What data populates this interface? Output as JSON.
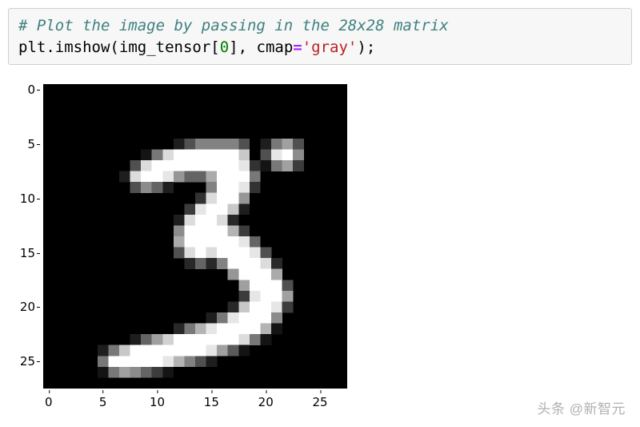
{
  "code": {
    "comment": "# Plot the image by passing in the 28x28 matrix",
    "line2": {
      "obj": "plt",
      "dot": ".",
      "fn": "imshow",
      "open": "(",
      "var": "img_tensor",
      "lb": "[",
      "idx": "0",
      "rb": "]",
      "comma": ", ",
      "kw": "cmap",
      "eq": "=",
      "str": "'gray'",
      "close": ");"
    }
  },
  "chart_data": {
    "type": "heatmap",
    "title": "",
    "xlabel": "",
    "ylabel": "",
    "xlim": [
      -0.5,
      27.5
    ],
    "ylim": [
      27.5,
      -0.5
    ],
    "xticks": [
      0,
      5,
      10,
      15,
      20,
      25
    ],
    "yticks": [
      0,
      5,
      10,
      15,
      20,
      25
    ],
    "cmap": "gray",
    "shape": [
      28,
      28
    ],
    "values": [
      [
        0,
        0,
        0,
        0,
        0,
        0,
        0,
        0,
        0,
        0,
        0,
        0,
        0,
        0,
        0,
        0,
        0,
        0,
        0,
        0,
        0,
        0,
        0,
        0,
        0,
        0,
        0,
        0
      ],
      [
        0,
        0,
        0,
        0,
        0,
        0,
        0,
        0,
        0,
        0,
        0,
        0,
        0,
        0,
        0,
        0,
        0,
        0,
        0,
        0,
        0,
        0,
        0,
        0,
        0,
        0,
        0,
        0
      ],
      [
        0,
        0,
        0,
        0,
        0,
        0,
        0,
        0,
        0,
        0,
        0,
        0,
        0,
        0,
        0,
        0,
        0,
        0,
        0,
        0,
        0,
        0,
        0,
        0,
        0,
        0,
        0,
        0
      ],
      [
        0,
        0,
        0,
        0,
        0,
        0,
        0,
        0,
        0,
        0,
        0,
        0,
        0,
        0,
        0,
        0,
        0,
        0,
        0,
        0,
        0,
        0,
        0,
        0,
        0,
        0,
        0,
        0
      ],
      [
        0,
        0,
        0,
        0,
        0,
        0,
        0,
        0,
        0,
        0,
        0,
        0,
        0,
        0,
        0,
        0,
        0,
        0,
        0,
        0,
        0,
        0,
        0,
        0,
        0,
        0,
        0,
        0
      ],
      [
        0,
        0,
        0,
        0,
        0,
        0,
        0,
        0,
        0,
        0,
        0,
        0,
        30,
        80,
        130,
        130,
        130,
        130,
        80,
        0,
        30,
        120,
        160,
        80,
        0,
        0,
        0,
        0
      ],
      [
        0,
        0,
        0,
        0,
        0,
        0,
        0,
        0,
        0,
        20,
        120,
        220,
        255,
        255,
        255,
        255,
        255,
        255,
        200,
        0,
        80,
        230,
        255,
        140,
        0,
        0,
        0,
        0
      ],
      [
        0,
        0,
        0,
        0,
        0,
        0,
        0,
        0,
        80,
        220,
        255,
        255,
        255,
        255,
        255,
        255,
        255,
        255,
        230,
        50,
        20,
        120,
        160,
        60,
        0,
        0,
        0,
        0
      ],
      [
        0,
        0,
        0,
        0,
        0,
        0,
        0,
        30,
        220,
        255,
        255,
        230,
        150,
        100,
        100,
        170,
        255,
        255,
        255,
        120,
        0,
        0,
        0,
        0,
        0,
        0,
        0,
        0
      ],
      [
        0,
        0,
        0,
        0,
        0,
        0,
        0,
        0,
        80,
        140,
        100,
        30,
        0,
        0,
        0,
        130,
        255,
        255,
        230,
        50,
        0,
        0,
        0,
        0,
        0,
        0,
        0,
        0
      ],
      [
        0,
        0,
        0,
        0,
        0,
        0,
        0,
        0,
        0,
        0,
        0,
        0,
        0,
        0,
        50,
        220,
        255,
        255,
        150,
        0,
        0,
        0,
        0,
        0,
        0,
        0,
        0,
        0
      ],
      [
        0,
        0,
        0,
        0,
        0,
        0,
        0,
        0,
        0,
        0,
        0,
        0,
        0,
        60,
        230,
        255,
        255,
        200,
        30,
        0,
        0,
        0,
        0,
        0,
        0,
        0,
        0,
        0
      ],
      [
        0,
        0,
        0,
        0,
        0,
        0,
        0,
        0,
        0,
        0,
        0,
        0,
        30,
        220,
        255,
        255,
        220,
        40,
        0,
        0,
        0,
        0,
        0,
        0,
        0,
        0,
        0,
        0
      ],
      [
        0,
        0,
        0,
        0,
        0,
        0,
        0,
        0,
        0,
        0,
        0,
        0,
        140,
        255,
        255,
        255,
        255,
        180,
        60,
        0,
        0,
        0,
        0,
        0,
        0,
        0,
        0,
        0
      ],
      [
        0,
        0,
        0,
        0,
        0,
        0,
        0,
        0,
        0,
        0,
        0,
        0,
        170,
        255,
        255,
        255,
        255,
        255,
        230,
        100,
        0,
        0,
        0,
        0,
        0,
        0,
        0,
        0
      ],
      [
        0,
        0,
        0,
        0,
        0,
        0,
        0,
        0,
        0,
        0,
        0,
        0,
        80,
        220,
        255,
        220,
        255,
        255,
        255,
        230,
        80,
        0,
        0,
        0,
        0,
        0,
        0,
        0
      ],
      [
        0,
        0,
        0,
        0,
        0,
        0,
        0,
        0,
        0,
        0,
        0,
        0,
        0,
        40,
        100,
        40,
        130,
        255,
        255,
        255,
        220,
        40,
        0,
        0,
        0,
        0,
        0,
        0
      ],
      [
        0,
        0,
        0,
        0,
        0,
        0,
        0,
        0,
        0,
        0,
        0,
        0,
        0,
        0,
        0,
        0,
        0,
        150,
        255,
        255,
        255,
        170,
        0,
        0,
        0,
        0,
        0,
        0
      ],
      [
        0,
        0,
        0,
        0,
        0,
        0,
        0,
        0,
        0,
        0,
        0,
        0,
        0,
        0,
        0,
        0,
        0,
        0,
        160,
        255,
        255,
        255,
        80,
        0,
        0,
        0,
        0,
        0
      ],
      [
        0,
        0,
        0,
        0,
        0,
        0,
        0,
        0,
        0,
        0,
        0,
        0,
        0,
        0,
        0,
        0,
        0,
        0,
        60,
        230,
        255,
        255,
        160,
        0,
        0,
        0,
        0,
        0
      ],
      [
        0,
        0,
        0,
        0,
        0,
        0,
        0,
        0,
        0,
        0,
        0,
        0,
        0,
        0,
        0,
        0,
        0,
        40,
        200,
        255,
        255,
        230,
        60,
        0,
        0,
        0,
        0,
        0
      ],
      [
        0,
        0,
        0,
        0,
        0,
        0,
        0,
        0,
        0,
        0,
        0,
        0,
        0,
        0,
        0,
        30,
        120,
        230,
        255,
        255,
        255,
        140,
        0,
        0,
        0,
        0,
        0,
        0
      ],
      [
        0,
        0,
        0,
        0,
        0,
        0,
        0,
        0,
        0,
        0,
        0,
        0,
        40,
        120,
        180,
        230,
        255,
        255,
        255,
        255,
        180,
        20,
        0,
        0,
        0,
        0,
        0,
        0
      ],
      [
        0,
        0,
        0,
        0,
        0,
        0,
        0,
        0,
        30,
        100,
        160,
        210,
        255,
        255,
        255,
        255,
        255,
        255,
        220,
        120,
        20,
        0,
        0,
        0,
        0,
        0,
        0,
        0
      ],
      [
        0,
        0,
        0,
        0,
        0,
        30,
        120,
        200,
        255,
        255,
        255,
        255,
        255,
        255,
        255,
        230,
        160,
        90,
        20,
        0,
        0,
        0,
        0,
        0,
        0,
        0,
        0,
        0
      ],
      [
        0,
        0,
        0,
        0,
        0,
        120,
        255,
        255,
        255,
        255,
        255,
        230,
        180,
        130,
        80,
        30,
        0,
        0,
        0,
        0,
        0,
        0,
        0,
        0,
        0,
        0,
        0,
        0
      ],
      [
        0,
        0,
        0,
        0,
        0,
        20,
        120,
        160,
        140,
        100,
        60,
        20,
        0,
        0,
        0,
        0,
        0,
        0,
        0,
        0,
        0,
        0,
        0,
        0,
        0,
        0,
        0,
        0
      ],
      [
        0,
        0,
        0,
        0,
        0,
        0,
        0,
        0,
        0,
        0,
        0,
        0,
        0,
        0,
        0,
        0,
        0,
        0,
        0,
        0,
        0,
        0,
        0,
        0,
        0,
        0,
        0,
        0
      ]
    ]
  },
  "footer": {
    "credit": "头条 @新智元"
  }
}
